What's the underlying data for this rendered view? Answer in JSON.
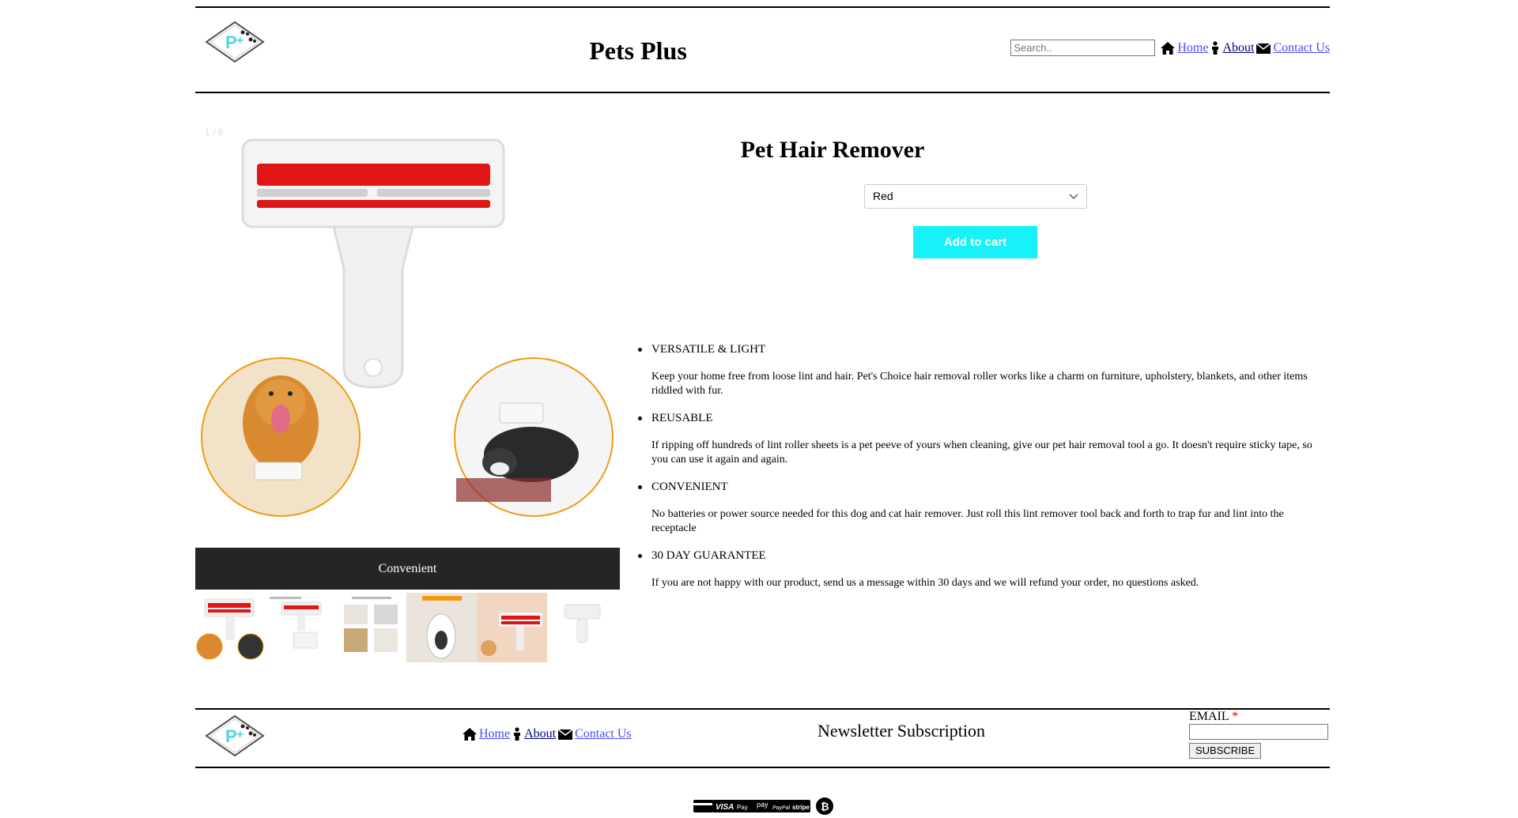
{
  "header": {
    "site_title": "Pets Plus",
    "search_placeholder": "Search..",
    "nav": [
      {
        "label": "Home",
        "icon": "home-icon"
      },
      {
        "label": "About",
        "icon": "person-icon"
      },
      {
        "label": "Contact Us",
        "icon": "envelope-icon"
      }
    ]
  },
  "gallery": {
    "counter": "1 / 6",
    "caption": "Convenient",
    "thumbnail_count": 6
  },
  "product": {
    "title": "Pet Hair Remover",
    "variant_selected": "Red",
    "add_to_cart_label": "Add to cart",
    "accent_color": "#17f2f8",
    "features": [
      {
        "title": "VERSATILE & LIGHT",
        "description": "Keep your home free from loose lint and hair. Pet's Choice hair removal roller works like a charm on furniture, upholstery, blankets, and other items riddled with fur."
      },
      {
        "title": "REUSABLE",
        "description": "If ripping off hundreds of lint roller sheets is a pet peeve of yours when cleaning, give our pet hair removal tool a go. It doesn't require sticky tape, so you can use it again and again."
      },
      {
        "title": "CONVENIENT",
        "description": "No batteries or power source needed for this dog and cat hair remover. Just roll this lint remover tool back and forth to trap fur and lint into the receptacle"
      },
      {
        "title": "30 DAY GUARANTEE",
        "description": "If you are not happy with our product, send us a message within 30 days and we will refund your order, no questions asked."
      }
    ]
  },
  "footer": {
    "nav": [
      {
        "label": "Home",
        "icon": "home-icon"
      },
      {
        "label": "About",
        "icon": "person-icon"
      },
      {
        "label": "Contact Us",
        "icon": "envelope-icon"
      }
    ],
    "newsletter_title": "Newsletter Subscription",
    "email_label": "EMAIL",
    "required_mark": "*",
    "subscribe_label": "SUBSCRIBE"
  },
  "payments": {
    "labels": [
      "VISA",
      "Pay",
      "pay",
      "PayPal",
      "stripe"
    ]
  }
}
